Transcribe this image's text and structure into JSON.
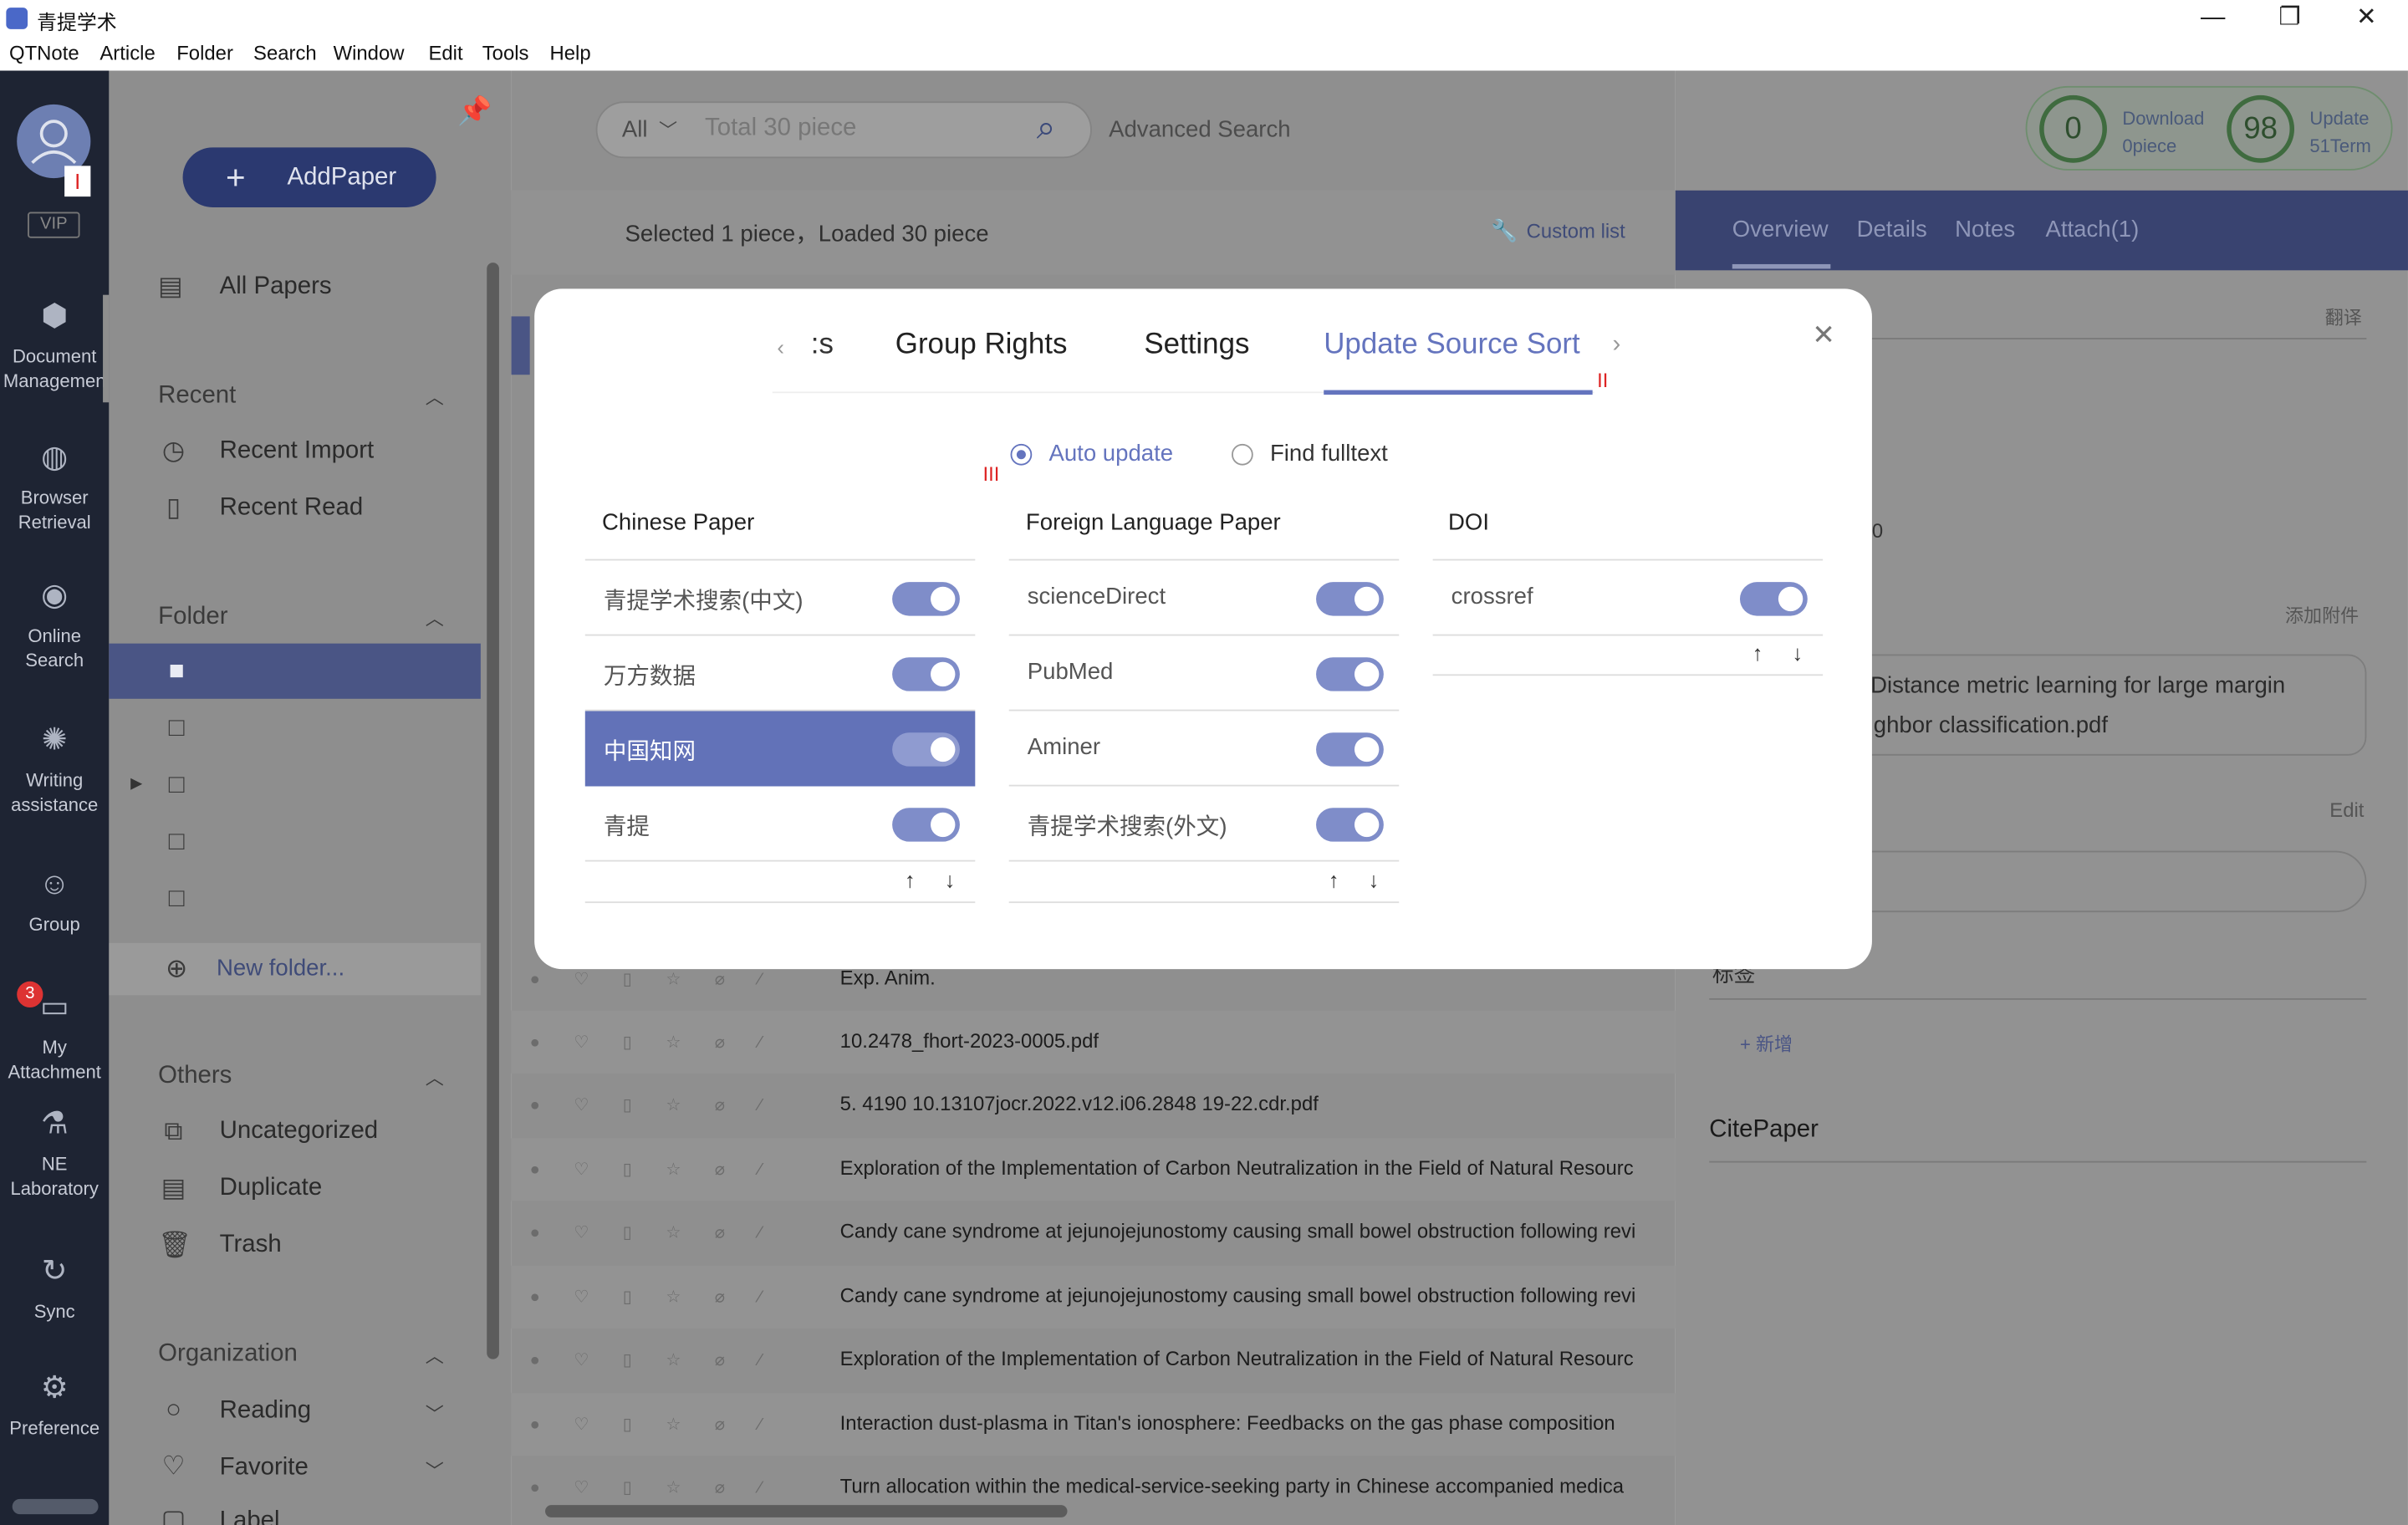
{
  "app": {
    "title": "青提学术",
    "win_min": "—",
    "win_max": "❐",
    "win_close": "✕"
  },
  "menu": [
    "QTNote",
    "Article",
    "Folder",
    "Search",
    "Window",
    "Edit",
    "Tools",
    "Help"
  ],
  "nav": {
    "vip": "VIP",
    "items": [
      {
        "label1": "Document",
        "label2": "Managemen"
      },
      {
        "label1": "Browser",
        "label2": "Retrieval"
      },
      {
        "label1": "Online",
        "label2": "Search"
      },
      {
        "label1": "Writing",
        "label2": "assistance"
      },
      {
        "label1": "Group",
        "label2": ""
      },
      {
        "label1": "My",
        "label2": "Attachment"
      },
      {
        "label1": "NE",
        "label2": "Laboratory"
      },
      {
        "label1": "Sync",
        "label2": ""
      },
      {
        "label1": "Preference",
        "label2": ""
      }
    ],
    "attachment_badge": "3"
  },
  "sidebar": {
    "add_button": "AddPaper",
    "all_papers": "All Papers",
    "recent_head": "Recent",
    "recent_import": "Recent Import",
    "recent_read": "Recent Read",
    "folder_head": "Folder",
    "new_folder": "New folder...",
    "others_head": "Others",
    "uncategorized": "Uncategorized",
    "duplicate": "Duplicate",
    "trash": "Trash",
    "organization_head": "Organization",
    "reading": "Reading",
    "favorite": "Favorite",
    "label": "Label"
  },
  "search": {
    "scope": "All",
    "placeholder": "Total 30 piece",
    "advanced": "Advanced Search"
  },
  "stats": {
    "download_count": "0",
    "download_label1": "Download",
    "download_label2": "0piece",
    "update_count": "98",
    "update_label1": "Update",
    "update_label2": "51Term"
  },
  "list": {
    "status": "Selected 1 piece，Loaded 30 piece",
    "custom_list": "Custom list",
    "rows": [
      "Exp. Anim.",
      "10.2478_fhort-2023-0005.pdf",
      "5. 4190 10.13107jocr.2022.v12.i06.2848 19-22.cdr.pdf",
      "Exploration of the Implementation of Carbon Neutralization in the Field of Natural Resourc",
      "Candy cane syndrome at jejunojejunostomy causing small bowel obstruction following revi",
      "Candy cane syndrome at jejunojejunostomy causing small bowel obstruction following revi",
      "Exploration of the Implementation of Carbon Neutralization in the Field of Natural Resourc",
      "Interaction dust-plasma in Titan's ionosphere: Feedbacks on the gas phase composition",
      "Turn allocation within the medical-service-seeking party in Chinese accompanied medica"
    ]
  },
  "detail": {
    "tabs": [
      "Overview",
      "Details",
      "Notes",
      "Attach(1)"
    ],
    "translate": "翻译",
    "partial_zero": "0",
    "add_attach": "添加附件",
    "attach_line1": "Distance metric learning for large margin",
    "attach_line2": "ghbor classification.pdf",
    "edit": "Edit",
    "tag_head": "标签",
    "add_new": "+ 新增",
    "cite": "CitePaper"
  },
  "modal": {
    "tab_partial": ":s",
    "tabs": [
      "Group Rights",
      "Settings",
      "Update Source Sort"
    ],
    "active_tab": "Update Source Sort",
    "radio_auto": "Auto update",
    "radio_full": "Find fulltext",
    "marker1": "I",
    "marker2": "II",
    "marker3": "III",
    "columns": [
      {
        "head": "Chinese Paper",
        "items": [
          "青提学术搜索(中文)",
          "万方数据",
          "中国知网",
          "青提"
        ],
        "selected": "中国知网"
      },
      {
        "head": "Foreign Language Paper",
        "items": [
          "scienceDirect",
          "PubMed",
          "Aminer",
          "青提学术搜索(外文)"
        ]
      },
      {
        "head": "DOI",
        "items": [
          "crossref"
        ]
      }
    ],
    "colors": {
      "accent": "#6070b8",
      "toggle": "#7f8dc9",
      "selected_row": "#6272b8"
    }
  }
}
